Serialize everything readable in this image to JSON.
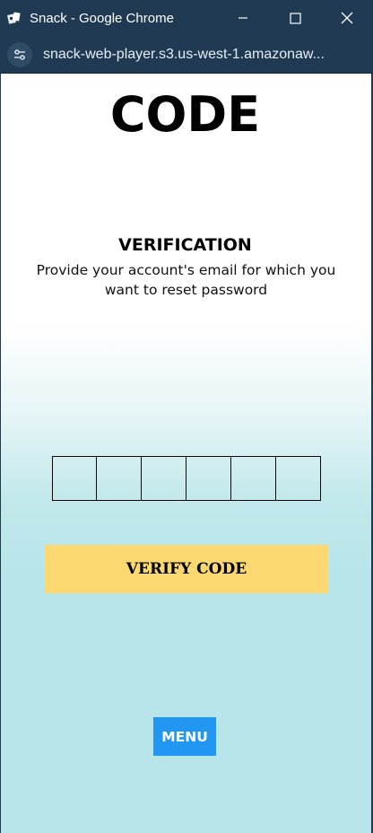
{
  "window": {
    "title": "Snack - Google Chrome",
    "app_icon": "snack-icon",
    "controls": [
      "minimize-icon",
      "maximize-icon",
      "close-icon"
    ]
  },
  "browser": {
    "url": "snack-web-player.s3.us-west-1.amazonaw...",
    "site_info_icon": "site-settings-icon"
  },
  "screen": {
    "title": "CODE",
    "subtitle": "VERIFICATION",
    "description": "Provide your account's email for which you want to reset password",
    "code_length": 6,
    "verify_label": "VERIFY CODE",
    "menu_label": "MENU"
  },
  "colors": {
    "chrome_bg": "#1f3a52",
    "verify_button": "#fbd970",
    "menu_button": "#2196f3",
    "page_bottom": "#b7e5e9"
  }
}
